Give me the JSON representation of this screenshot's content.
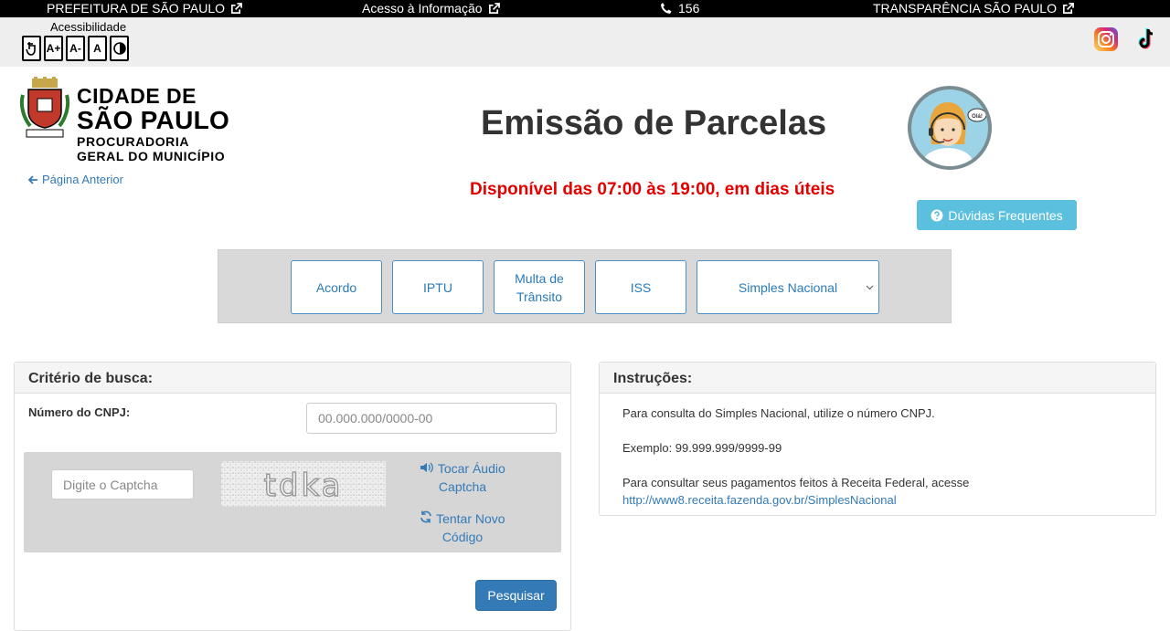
{
  "topbar": {
    "prefeitura": "PREFEITURA DE SÃO PAULO",
    "acesso": "Acesso à Informação",
    "phone": "156",
    "transparencia": "TRANSPARÊNCIA SÃO PAULO"
  },
  "accessibility": {
    "label": "Acessibilidade",
    "buttons": [
      "A+",
      "A-",
      "A"
    ]
  },
  "header": {
    "logo_line1": "CIDADE DE",
    "logo_line2": "SÃO PAULO",
    "logo_line3": "PROCURADORIA",
    "logo_line4": "GERAL DO MUNICÍPIO",
    "back_link": "Página Anterior",
    "title": "Emissão de Parcelas",
    "availability": "Disponível das 07:00 às 19:00, em dias úteis",
    "avatar_bubble": "Olá!",
    "faq_button": "Dúvidas Frequentes"
  },
  "tabs": {
    "acordo": "Acordo",
    "iptu": "IPTU",
    "multa_l1": "Multa de",
    "multa_l2": "Trânsito",
    "iss": "ISS",
    "simples": "Simples Nacional"
  },
  "search": {
    "heading": "Critério de busca:",
    "cnpj_label": "Número do CNPJ:",
    "cnpj_placeholder": "00.000.000/0000-00",
    "captcha_placeholder": "Digite o Captcha",
    "captcha_text": "tdka",
    "audio_l1": "Tocar Áudio",
    "audio_l2": "Captcha",
    "retry_l1": "Tentar Novo",
    "retry_l2": "Código",
    "submit": "Pesquisar"
  },
  "instructions": {
    "heading": "Instruções:",
    "line1": "Para consulta do Simples Nacional, utilize o número CNPJ.",
    "line2": "Exemplo: 99.999.999/9999-99",
    "line3": "Para consultar seus pagamentos feitos à Receita Federal, acesse",
    "link": "http://www8.receita.fazenda.gov.br/SimplesNacional"
  },
  "colors": {
    "primary": "#337ab7",
    "info": "#5bc0de",
    "danger": "#e50000",
    "tab_border": "#4a90c8"
  },
  "icons": [
    "external-link-icon",
    "phone-icon",
    "instagram-icon",
    "tiktok-icon",
    "arrow-left-icon",
    "question-circle-icon",
    "chevron-down-icon",
    "volume-icon",
    "refresh-icon",
    "contrast-icon",
    "hand-pointer-icon"
  ]
}
